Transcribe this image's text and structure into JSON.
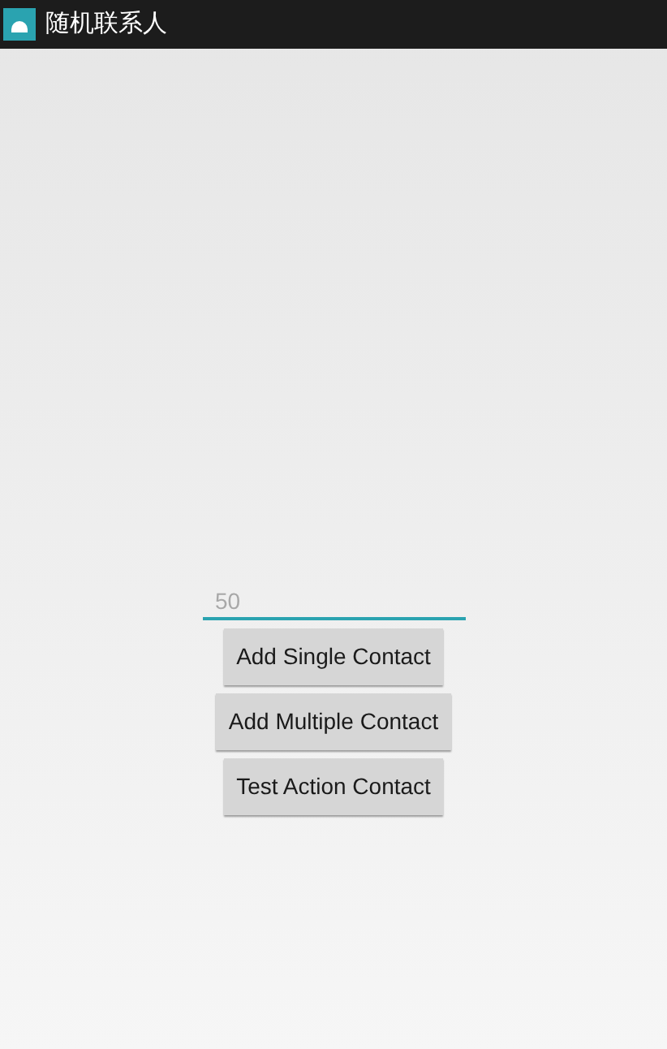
{
  "window": {
    "title": "随机联系人"
  },
  "count_field": {
    "placeholder": "50"
  },
  "buttons": [
    "Add Single Contact",
    "Add Multiple Contact",
    "Test Action Contact"
  ]
}
